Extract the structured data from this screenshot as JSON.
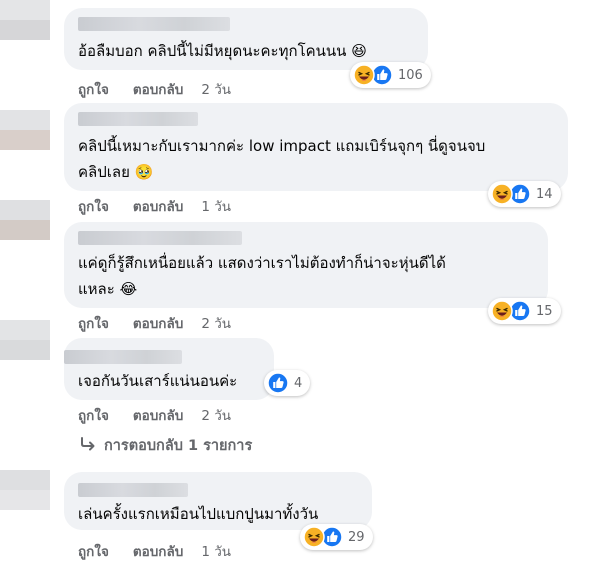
{
  "actions": {
    "like": "ถูกใจ",
    "reply": "ตอบกลับ"
  },
  "comments": [
    {
      "text": [
        "อ้อลืมบอก คลิปนี้ไม่มีหยุดนะคะทุกโคนนน 😆"
      ],
      "time": "2 วัน",
      "reaction_count": "106",
      "reactions": [
        "haha",
        "like"
      ]
    },
    {
      "text": [
        "คลิปนี้เหมาะกับเรามากค่ะ low impact แถมเบิร์นจุกๆ นี่ดูจนจบ",
        "คลิปเลย 🥹"
      ],
      "time": "1 วัน",
      "reaction_count": "14",
      "reactions": [
        "haha",
        "like"
      ]
    },
    {
      "text": [
        "แค่ดูก็รู้สึกเหนื่อยแล้ว แสดงว่าเราไม่ต้องทำก็น่าจะหุ่นดีได้",
        "แหละ 😂"
      ],
      "time": "2 วัน",
      "reaction_count": "15",
      "reactions": [
        "haha",
        "like"
      ]
    },
    {
      "text": [
        "เจอกันวันเสาร์แน่นอนค่ะ"
      ],
      "time": "2 วัน",
      "reaction_count": "4",
      "reactions": [
        "like"
      ]
    },
    {
      "text": [
        "เล่นครั้งแรกเหมือนไปแบกปูนมาทั้งวัน"
      ],
      "time": "1 วัน",
      "reaction_count": "29",
      "reactions": [
        "haha",
        "like"
      ]
    }
  ],
  "replies_link": {
    "arrow_icon": "reply-arrow-icon",
    "label": "การตอบกลับ 1 รายการ"
  },
  "colors": {
    "bubble": "#f0f2f5",
    "meta_text": "#65676b",
    "like_blue": "#1877f2",
    "haha_yellow": "#f7b125"
  }
}
